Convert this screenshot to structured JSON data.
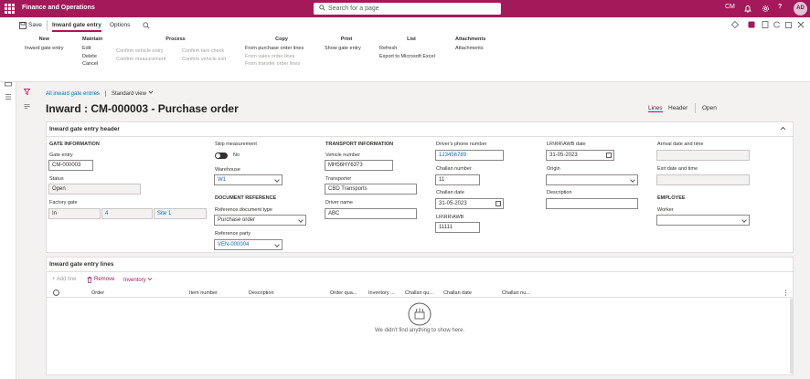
{
  "app": {
    "title": "Finance and Operations"
  },
  "search": {
    "placeholder": "Search for a page"
  },
  "topbar": {
    "company": "CM",
    "avatar": "AD"
  },
  "tabs": {
    "save": "Save",
    "inward": "Inward gate entry",
    "options": "Options"
  },
  "action_groups": {
    "new": {
      "title": "New",
      "items": [
        "Inward gate entry"
      ]
    },
    "maintain": {
      "title": "Maintain",
      "items": [
        "Edit",
        "Delete",
        "Cancel"
      ]
    },
    "process": {
      "title": "Process",
      "col1": [
        "Confirm vehicle entry",
        "Confirm measurement"
      ],
      "col2": [
        "Confirm tare check",
        "Confirm vehicle exit"
      ]
    },
    "copy": {
      "title": "Copy",
      "items": [
        "From purchase order lines",
        "From sales order lines",
        "From transfer order lines"
      ]
    },
    "print": {
      "title": "Print",
      "items": [
        "Show gate entry"
      ]
    },
    "list": {
      "title": "List",
      "items": [
        "Refresh",
        "Export to Microsoft Excel"
      ]
    },
    "attachments": {
      "title": "Attachments",
      "items": [
        "Attachments"
      ]
    }
  },
  "breadcrumb": {
    "link": "All inward gate entries",
    "sep": "|",
    "view": "Standard view"
  },
  "page": {
    "title": "Inward : CM-000003 - Purchase order"
  },
  "view_switch": {
    "lines": "Lines",
    "header": "Header",
    "open": "Open"
  },
  "header_section": {
    "title": "Inward gate entry header",
    "gate_info": "GATE INFORMATION",
    "gate_entry_label": "Gate entry",
    "gate_entry": "CM-000003",
    "status_label": "Status",
    "status": "Open",
    "factory_gate_label": "Factory gate",
    "factory_gate": [
      "In",
      "4",
      "Site 1"
    ],
    "skip_label": "Skip measurement",
    "skip_value": "No",
    "warehouse_label": "Warehouse",
    "warehouse": "W1",
    "doc_ref": "DOCUMENT REFERENCE",
    "ref_doc_type_label": "Reference document type",
    "ref_doc_type": "Purchase order",
    "ref_party_label": "Reference party",
    "ref_party": "VEN-000004",
    "transport_info": "TRANSPORT INFORMATION",
    "vehicle_label": "Vehicle number",
    "vehicle": "MH56HY6373",
    "transporter_label": "Transporter",
    "transporter": "CBD Transports",
    "driver_label": "Driver name",
    "driver": "ABC",
    "phone_label": "Driver's phone number",
    "phone": "123456789",
    "challan_no_label": "Challan number",
    "challan_no": "11",
    "challan_date_label": "Challan date",
    "challan_date": "31-05-2023",
    "lr_label": "LR\\RR\\AWB",
    "lr": "11111",
    "lr_date_label": "LR\\RR\\AWB date",
    "lr_date": "31-05-2023",
    "origin_label": "Origin",
    "origin": "",
    "description_label": "Description",
    "description": "",
    "arrival_label": "Arrival date and time",
    "arrival": "",
    "exit_label": "Exit date and time",
    "exit": "",
    "employee": "EMPLOYEE",
    "worker_label": "Worker",
    "worker": ""
  },
  "lines_section": {
    "title": "Inward gate entry lines",
    "add_line": "+ Add line",
    "remove": "Remove",
    "inventory": "Inventory",
    "columns": [
      "Order",
      "Item number",
      "Description",
      "Order qua...",
      "Inventory ...",
      "Challan qu...",
      "Challan date",
      "Challan nu..."
    ],
    "empty": "We didn't find anything to show here."
  },
  "colors": {
    "brand": "#a4195a",
    "link": "#0f6cbd"
  }
}
